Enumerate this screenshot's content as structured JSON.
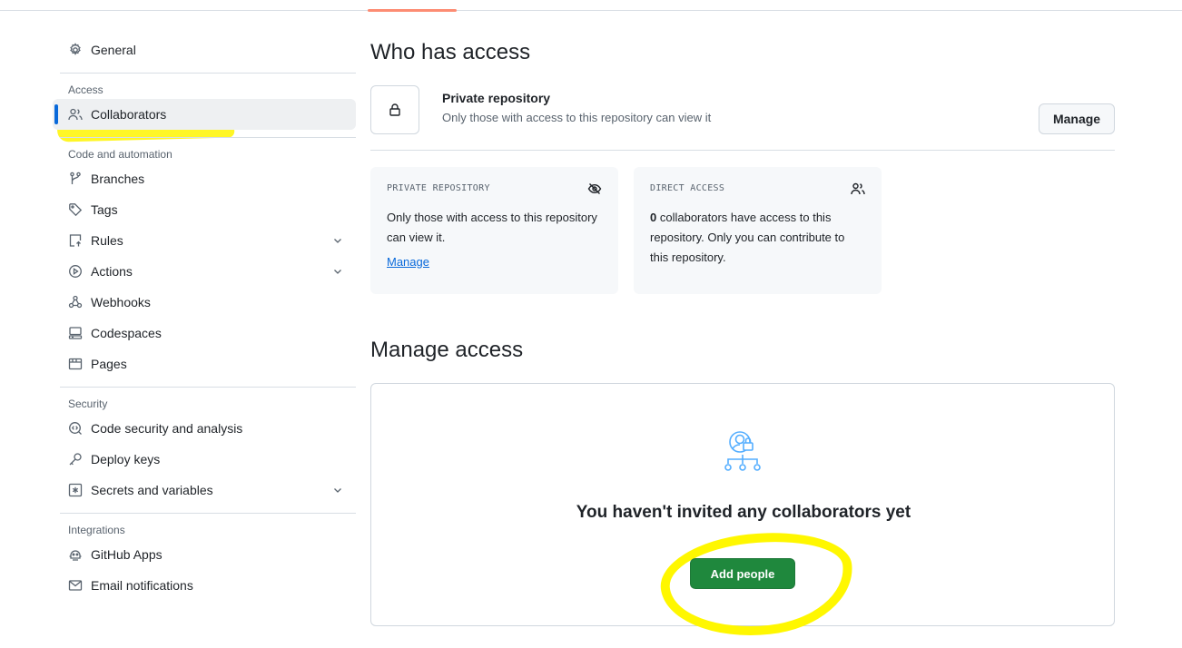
{
  "sidebar": {
    "general": "General",
    "sections": {
      "access": "Access",
      "code_automation": "Code and automation",
      "security": "Security",
      "integrations": "Integrations"
    },
    "items": {
      "collaborators": "Collaborators",
      "branches": "Branches",
      "tags": "Tags",
      "rules": "Rules",
      "actions": "Actions",
      "webhooks": "Webhooks",
      "codespaces": "Codespaces",
      "pages": "Pages",
      "code_security": "Code security and analysis",
      "deploy_keys": "Deploy keys",
      "secrets": "Secrets and variables",
      "github_apps": "GitHub Apps",
      "email_notifications": "Email notifications"
    },
    "active_item": "collaborators"
  },
  "who_has_access": {
    "title": "Who has access",
    "repo_title": "Private repository",
    "repo_desc": "Only those with access to this repository can view it",
    "manage_button": "Manage",
    "cards": {
      "private": {
        "caption": "PRIVATE REPOSITORY",
        "body": "Only those with access to this repository can view it.",
        "link": "Manage",
        "icon": "eye-closed-icon"
      },
      "direct": {
        "caption": "DIRECT ACCESS",
        "count": "0",
        "body": " collaborators have access to this repository. Only you can contribute to this repository.",
        "icon": "people-icon"
      }
    }
  },
  "manage_access": {
    "title": "Manage access",
    "empty_title": "You haven't invited any collaborators yet",
    "add_button": "Add people",
    "icon": "person-lock-icon"
  },
  "colors": {
    "accent": "#0969da",
    "primary_button": "#1f883d",
    "highlight": "#fff700"
  }
}
